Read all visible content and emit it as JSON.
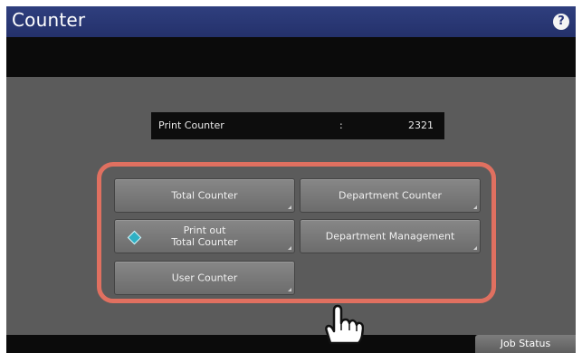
{
  "window": {
    "title": "Counter",
    "help_icon": "?"
  },
  "print_counter": {
    "label": "Print Counter",
    "separator": ":",
    "value": "2321"
  },
  "buttons": {
    "total_counter": "Total Counter",
    "department_counter": "Department Counter",
    "print_out_total_line1": "Print out",
    "print_out_total_line2": "Total Counter",
    "department_management": "Department Management",
    "user_counter": "User Counter"
  },
  "footer": {
    "job_status": "Job Status"
  },
  "colors": {
    "title_bar": "#2a377a",
    "panel": "#5b5b5b",
    "highlight": "#e07060",
    "diamond_icon": "#2fb0c4"
  }
}
